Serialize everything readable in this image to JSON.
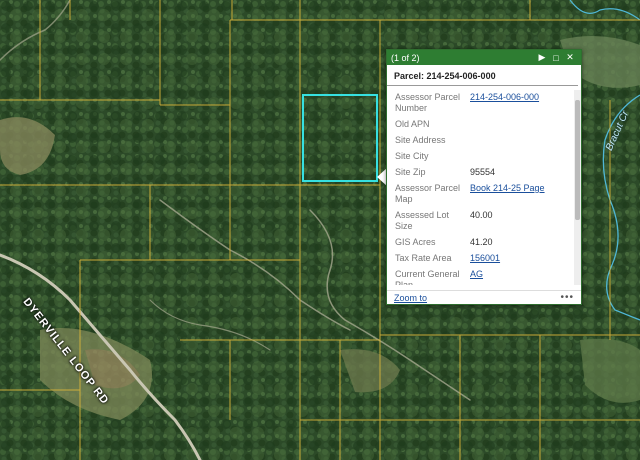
{
  "map": {
    "road_label": "DYERVILLE LOOP RD",
    "creek_label": "Bracut Cr"
  },
  "popup": {
    "count": "(1 of 2)",
    "next_icon": "▶",
    "maximize_icon": "□",
    "close_icon": "✕",
    "title": "Parcel: 214-254-006-000",
    "rows": [
      {
        "attr": "Assessor Parcel Number",
        "value": "214-254-006-000",
        "link": true
      },
      {
        "attr": "Old APN",
        "value": "",
        "link": false
      },
      {
        "attr": "Site Address",
        "value": "",
        "link": false
      },
      {
        "attr": "Site City",
        "value": "",
        "link": false
      },
      {
        "attr": "Site Zip",
        "value": "95554",
        "link": false
      },
      {
        "attr": "Assessor Parcel Map",
        "value": "Book 214-25 Page",
        "link": true
      },
      {
        "attr": "Assessed Lot Size",
        "value": "40.00",
        "link": false
      },
      {
        "attr": "GIS Acres",
        "value": "41.20",
        "link": false
      },
      {
        "attr": "Tax Rate Area",
        "value": "156001",
        "link": true
      },
      {
        "attr": "Current General Plan",
        "value": "AG",
        "link": true
      }
    ],
    "zoom_label": "Zoom to",
    "more_label": "•••"
  },
  "colors": {
    "header": "#2e7d32",
    "parcel_highlight": "#36e0e0",
    "parcel_lines": "#d9b43a",
    "link": "#1a4f9c"
  }
}
